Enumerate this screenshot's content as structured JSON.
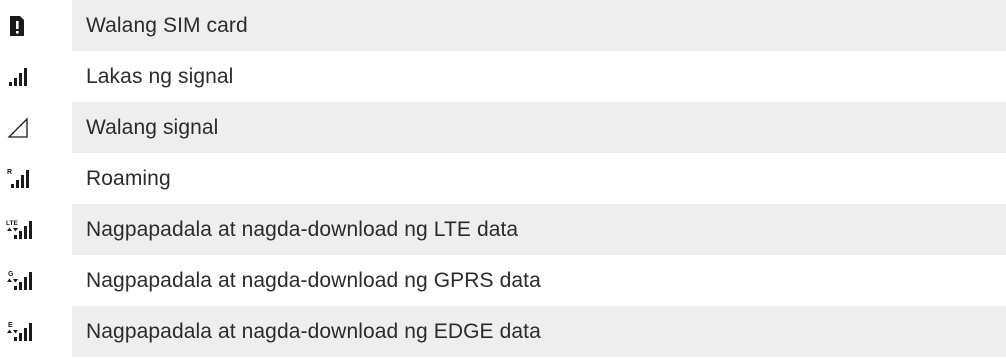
{
  "rows": [
    {
      "icon": "sim-missing-icon",
      "label": "Walang SIM card"
    },
    {
      "icon": "signal-strength-icon",
      "label": "Lakas ng signal"
    },
    {
      "icon": "no-signal-icon",
      "label": "Walang signal"
    },
    {
      "icon": "roaming-signal-icon",
      "label": "Roaming"
    },
    {
      "icon": "lte-data-icon",
      "label": "Nagpapadala at nagda-download ng LTE data"
    },
    {
      "icon": "gprs-data-icon",
      "label": "Nagpapadala at nagda-download ng GPRS data"
    },
    {
      "icon": "edge-data-icon",
      "label": "Nagpapadala at nagda-download ng EDGE data"
    }
  ],
  "icon_glyphs": {
    "roaming": "R",
    "lte": "LTE",
    "gprs": "G",
    "edge": "E"
  },
  "colors": {
    "icon": "#1a1a1a",
    "shade": "#eeeeee",
    "text": "#2b2b2b"
  }
}
